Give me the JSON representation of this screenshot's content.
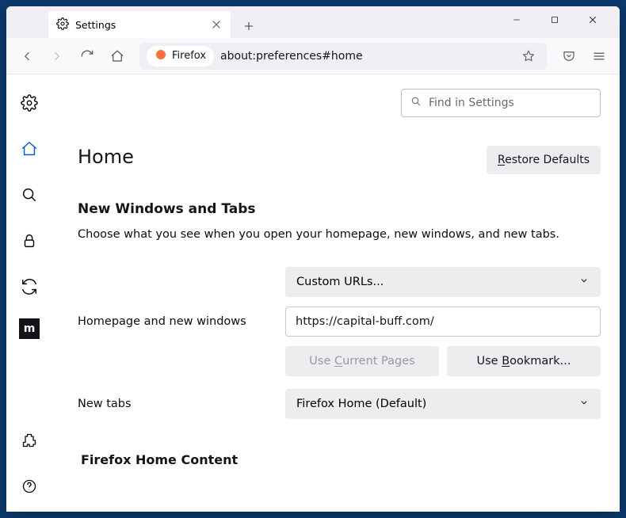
{
  "tab": {
    "title": "Settings"
  },
  "url": {
    "pill": "Firefox",
    "address": "about:preferences#home"
  },
  "search": {
    "placeholder": "Find in Settings"
  },
  "page": {
    "title": "Home",
    "restore_label": "Restore Defaults",
    "section1_title": "New Windows and Tabs",
    "section1_hint": "Choose what you see when you open your homepage, new windows, and new tabs.",
    "homepage_label": "Homepage and new windows",
    "homepage_select": "Custom URLs...",
    "homepage_value": "https://capital-buff.com/",
    "use_current": "Use Current Pages",
    "use_bookmark": "Use Bookmark...",
    "newtabs_label": "New tabs",
    "newtabs_select": "Firefox Home (Default)",
    "section2_title": "Firefox Home Content"
  }
}
